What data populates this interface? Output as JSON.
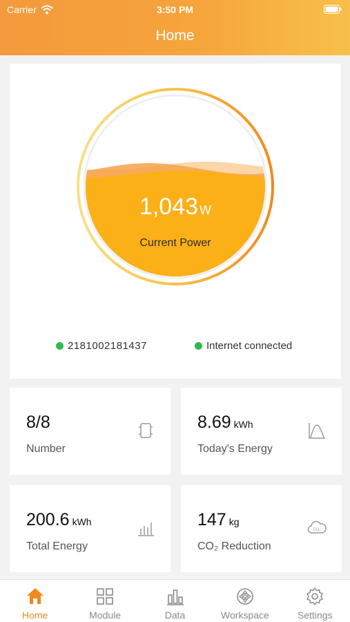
{
  "status_bar": {
    "carrier": "Carrier",
    "time": "3:50 PM"
  },
  "header": {
    "title": "Home"
  },
  "power": {
    "value": "1,043",
    "unit": "W",
    "label": "Current Power",
    "fill_fraction": 0.6
  },
  "status": {
    "serial": "2181002181437",
    "internet": "Internet connected"
  },
  "stats": [
    {
      "value": "8/8",
      "unit": "",
      "label": "Number",
      "icon": "module-chip-icon"
    },
    {
      "value": "8.69",
      "unit": "kWh",
      "label": "Today's Energy",
      "icon": "energy-curve-icon"
    },
    {
      "value": "200.6",
      "unit": "kWh",
      "label": "Total Energy",
      "icon": "bar-chart-icon"
    },
    {
      "value": "147",
      "unit": "kg",
      "label": "CO₂ Reduction",
      "icon": "co2-cloud-icon"
    }
  ],
  "tabs": [
    {
      "label": "Home",
      "icon": "home-icon",
      "active": true
    },
    {
      "label": "Module",
      "icon": "grid-icon",
      "active": false
    },
    {
      "label": "Data",
      "icon": "bar-chart-icon",
      "active": false
    },
    {
      "label": "Workspace",
      "icon": "workspace-icon",
      "active": false
    },
    {
      "label": "Settings",
      "icon": "gear-icon",
      "active": false
    }
  ],
  "colors": {
    "accent": "#f08a1c",
    "header_start": "#f39a3c",
    "header_end": "#f7c04a",
    "fill": "#fbb017",
    "online": "#2dbb4f"
  }
}
